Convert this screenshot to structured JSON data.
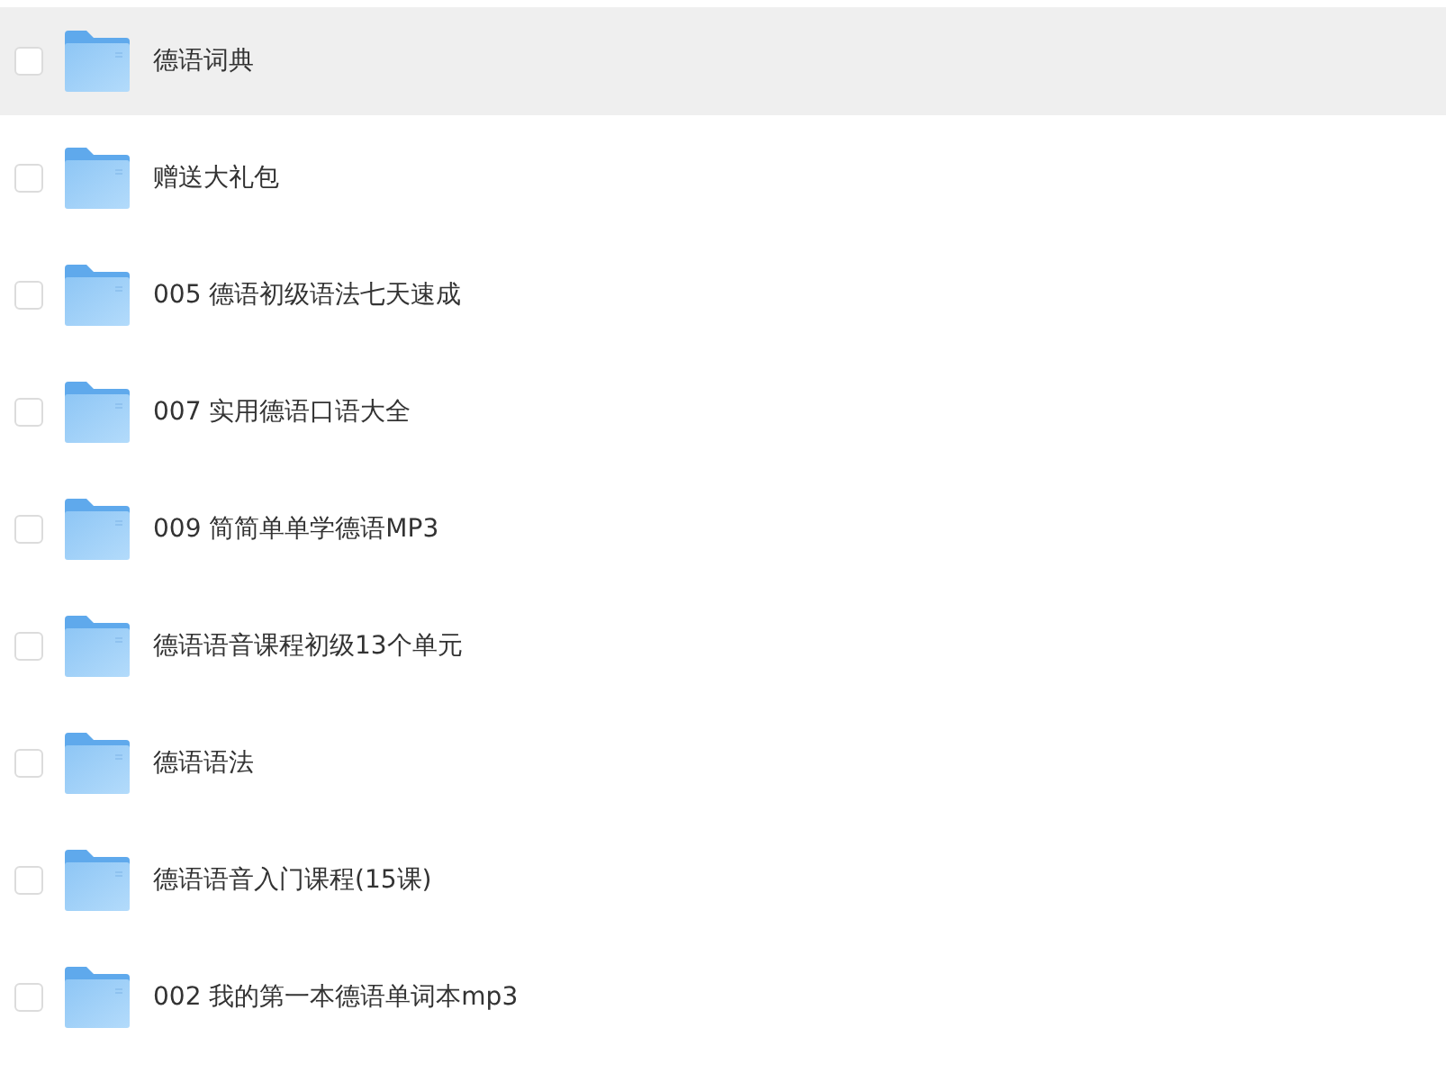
{
  "files": [
    {
      "name": "德语词典",
      "selected": true,
      "checked": false
    },
    {
      "name": "赠送大礼包",
      "selected": false,
      "checked": false
    },
    {
      "name": "005 德语初级语法七天速成",
      "selected": false,
      "checked": false
    },
    {
      "name": "007 实用德语口语大全",
      "selected": false,
      "checked": false
    },
    {
      "name": "009 简简单单学德语MP3",
      "selected": false,
      "checked": false
    },
    {
      "name": "德语语音课程初级13个单元",
      "selected": false,
      "checked": false
    },
    {
      "name": "德语语法",
      "selected": false,
      "checked": false
    },
    {
      "name": "德语语音入门课程(15课)",
      "selected": false,
      "checked": false
    },
    {
      "name": "002 我的第一本德语单词本mp3",
      "selected": false,
      "checked": false
    }
  ]
}
